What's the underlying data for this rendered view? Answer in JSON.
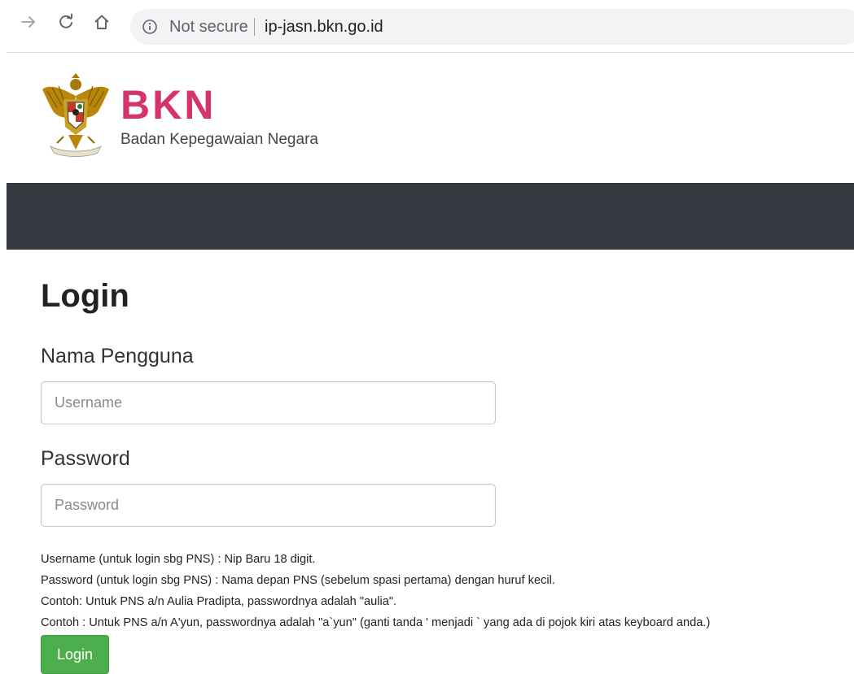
{
  "browser": {
    "security_label": "Not secure",
    "url": "ip-jasn.bkn.go.id"
  },
  "header": {
    "brand": "BKN",
    "subtitle": "Badan Kepegawaian Negara",
    "brand_color": "#d6336c",
    "navbar_color": "#343a40"
  },
  "form": {
    "title": "Login",
    "username_label": "Nama Pengguna",
    "username_placeholder": "Username",
    "username_value": "",
    "password_label": "Password",
    "password_placeholder": "Password",
    "password_value": "",
    "help": [
      "Username (untuk login sbg PNS) : Nip Baru 18 digit.",
      "Password (untuk login sbg PNS) : Nama depan PNS (sebelum spasi pertama) dengan huruf kecil.",
      "Contoh: Untuk PNS a/n Aulia Pradipta, passwordnya adalah \"aulia\".",
      "Contoh : Untuk PNS a/n A'yun, passwordnya adalah \"a`yun\" (ganti tanda ' menjadi ` yang ada di pojok kiri atas keyboard anda.)"
    ],
    "submit_label": "Login",
    "submit_color": "#4cae4c"
  }
}
